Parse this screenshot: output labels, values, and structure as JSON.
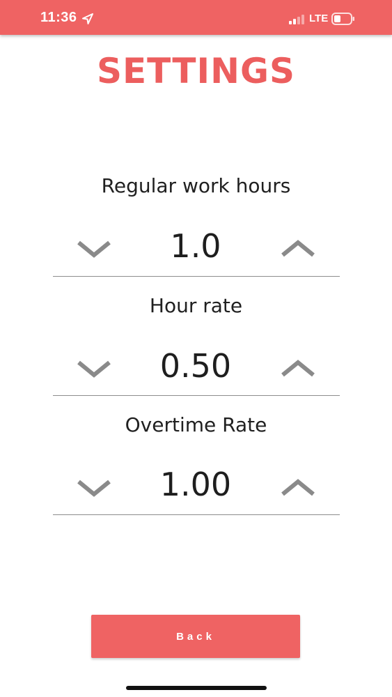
{
  "status_bar": {
    "time": "11:36",
    "network": "LTE",
    "location_icon": "location-arrow-icon",
    "signal_icon": "signal-bars-icon",
    "battery_icon": "battery-icon",
    "background_color": "#ef6363"
  },
  "title": "SETTINGS",
  "settings": [
    {
      "label": "Regular work hours",
      "value": "1.0"
    },
    {
      "label": "Hour rate",
      "value": "0.50"
    },
    {
      "label": "Overtime Rate",
      "value": "1.00"
    }
  ],
  "icons": {
    "decrease": "chevron-down-icon",
    "increase": "chevron-up-icon"
  },
  "back_button": {
    "label": "Back",
    "color": "#ef6363"
  },
  "accent_color": "#ec5e5e"
}
